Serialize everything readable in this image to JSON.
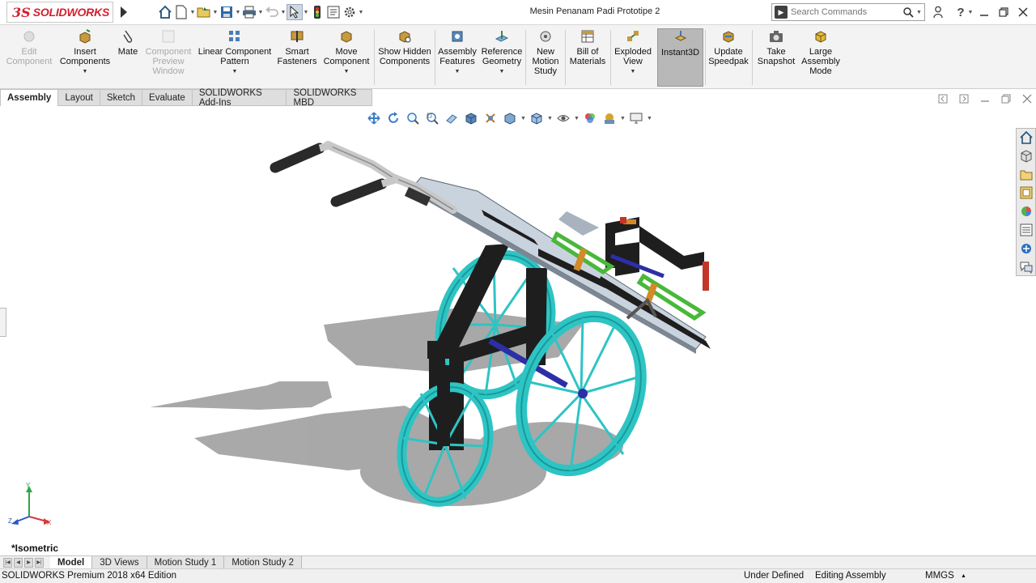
{
  "app": {
    "logo_prefix": "3S",
    "logo_word": "SOLIDWORKS",
    "document_title": "Mesin Penanam Padi Prototipe 2"
  },
  "quick_access": [
    "home-icon",
    "new-document-icon",
    "open-folder-icon",
    "save-icon",
    "print-icon",
    "undo-icon",
    "select-arrow-icon",
    "rebuild-traffic-light-icon",
    "file-properties-icon",
    "options-gear-icon"
  ],
  "search": {
    "placeholder": "Search Commands"
  },
  "window_controls": [
    "user-icon",
    "help-icon",
    "minimize-icon",
    "restore-icon",
    "close-icon"
  ],
  "command_manager": [
    {
      "id": "edit-component",
      "label": "Edit Component",
      "enabled": false
    },
    {
      "id": "insert-components",
      "label": "Insert Components",
      "enabled": true,
      "dropdown": true
    },
    {
      "id": "mate",
      "label": "Mate",
      "enabled": true
    },
    {
      "id": "component-preview-window",
      "label": "Component Preview Window",
      "enabled": false
    },
    {
      "id": "linear-component-pattern",
      "label": "Linear Component Pattern",
      "enabled": true,
      "dropdown": true
    },
    {
      "id": "smart-fasteners",
      "label": "Smart Fasteners",
      "enabled": true
    },
    {
      "id": "move-component",
      "label": "Move Component",
      "enabled": true,
      "dropdown": true
    },
    {
      "id": "show-hidden-components",
      "label": "Show Hidden Components",
      "enabled": true
    },
    {
      "id": "assembly-features",
      "label": "Assembly Features",
      "enabled": true,
      "dropdown": true
    },
    {
      "id": "reference-geometry",
      "label": "Reference Geometry",
      "enabled": true,
      "dropdown": true
    },
    {
      "id": "new-motion-study",
      "label": "New Motion Study",
      "enabled": true
    },
    {
      "id": "bill-of-materials",
      "label": "Bill of Materials",
      "enabled": true
    },
    {
      "id": "exploded-view",
      "label": "Exploded View",
      "enabled": true,
      "dropdown": true
    },
    {
      "id": "instant3d",
      "label": "Instant3D",
      "enabled": true,
      "active": true
    },
    {
      "id": "update-speedpak",
      "label": "Update Speedpak",
      "enabled": true
    },
    {
      "id": "take-snapshot",
      "label": "Take Snapshot",
      "enabled": true
    },
    {
      "id": "large-assembly-mode",
      "label": "Large Assembly Mode",
      "enabled": true
    }
  ],
  "tabs": [
    "Assembly",
    "Layout",
    "Sketch",
    "Evaluate",
    "SOLIDWORKS Add-Ins",
    "SOLIDWORKS MBD"
  ],
  "active_tab": "Assembly",
  "view": {
    "orientation_label": "*Isometric",
    "axes": [
      "Y",
      "Z",
      "X"
    ]
  },
  "bottom_tabs": [
    "Model",
    "3D Views",
    "Motion Study 1",
    "Motion Study 2"
  ],
  "active_bottom_tab": "Model",
  "status": {
    "edition": "SOLIDWORKS Premium 2018 x64 Edition",
    "definition": "Under Defined",
    "mode": "Editing Assembly",
    "units": "MMGS"
  },
  "colors": {
    "brand": "#d3202d",
    "wheel": "#2ec4c4",
    "frame": "#1e1e1e",
    "plate": "#c9d3de",
    "bracket": "#49b83a",
    "axle": "#2c2fa6"
  }
}
